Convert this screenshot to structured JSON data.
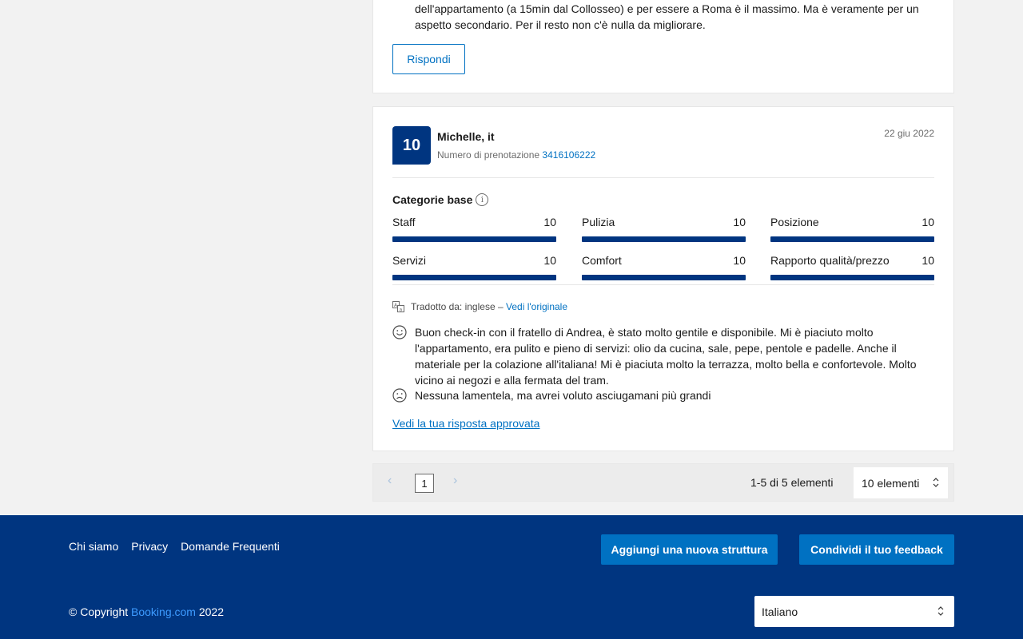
{
  "previous_review": {
    "text_line_1": "dell'appartamento (a 15min dal Collosseo) e per essere a Roma è il massimo. Ma è veramente per un",
    "text_line_2": "aspetto secondario. Per il resto non c'è nulla da migliorare.",
    "reply_button": "Rispondi"
  },
  "review": {
    "score": "10",
    "reviewer": "Michelle, it",
    "booking_label": "Numero di prenotazione",
    "booking_number": "3416106222",
    "date": "22 giu 2022",
    "categories_title": "Categorie base",
    "categories": [
      {
        "label": "Staff",
        "score": "10",
        "fill": 1.0
      },
      {
        "label": "Pulizia",
        "score": "10",
        "fill": 1.0
      },
      {
        "label": "Posizione",
        "score": "10",
        "fill": 1.0
      },
      {
        "label": "Servizi",
        "score": "10",
        "fill": 1.0
      },
      {
        "label": "Comfort",
        "score": "10",
        "fill": 1.0
      },
      {
        "label": "Rapporto qualità/prezzo",
        "score": "10",
        "fill": 1.0
      }
    ],
    "translated_label": "Tradotto da: inglese",
    "translated_sep": "–",
    "view_original": "Vedi l'originale",
    "positive": "Buon check-in con il fratello di Andrea, è stato molto gentile e disponibile. Mi è piaciuto molto l'appartamento, era pulito e pieno di servizi: olio da cucina, sale, pepe, pentole e padelle. Anche il materiale per la colazione all'italiana! Mi è piaciuta molto la terrazza, molto bella e confortevole. Molto vicino ai negozi e alla fermata del tram.",
    "negative": "Nessuna lamentela, ma avrei voluto asciugamani più grandi",
    "approved_link": "Vedi la tua risposta approvata"
  },
  "pagination": {
    "prev": "‹",
    "page": "1",
    "next": "›",
    "count": "1-5 di 5 elementi",
    "per_page": "10 elementi"
  },
  "footer": {
    "links": [
      "Chi siamo",
      "Privacy",
      "Domande Frequenti"
    ],
    "add_property": "Aggiungi una nuova struttura",
    "share_feedback": "Condividi il tuo feedback",
    "copyright_prefix": "© Copyright",
    "copyright_brand": "Booking.com",
    "copyright_year": "2022",
    "language": "Italiano"
  },
  "colors": {
    "brand_dark": "#003580",
    "brand_accent": "#0071c2"
  }
}
